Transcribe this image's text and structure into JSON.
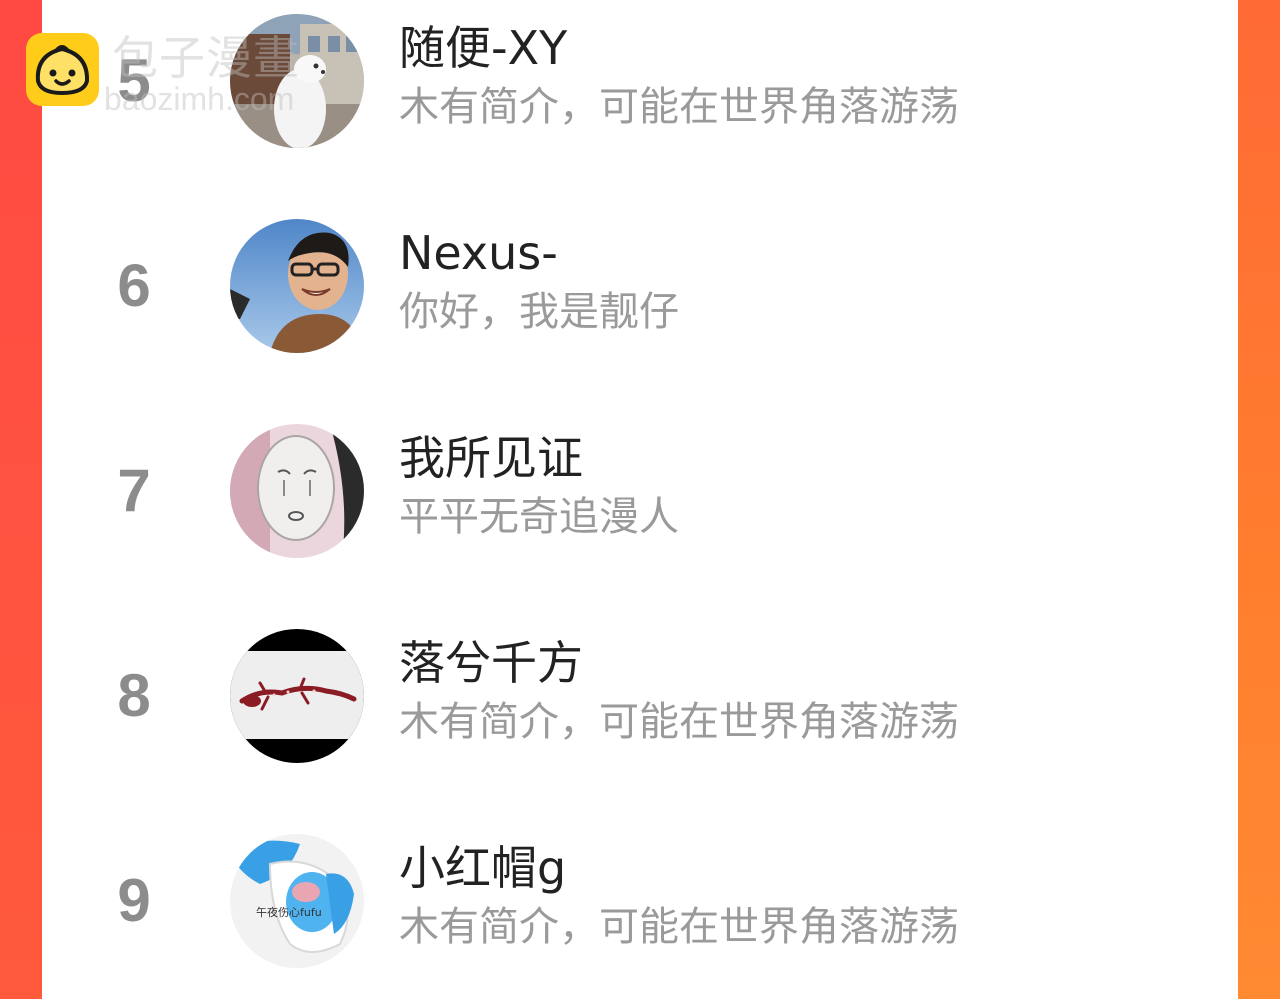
{
  "watermark": {
    "title": "包子漫畫",
    "url": "baozimh.com",
    "logo_icon": "bun-face-icon",
    "logo_color": "#ffcc1a"
  },
  "colors": {
    "side_left": "#ff4a44",
    "side_right": "#ff7f2e",
    "rank": "#8c8c8c",
    "name": "#222222",
    "bio": "#9a9a9a"
  },
  "list": [
    {
      "rank": "5",
      "name": "随便-XY",
      "bio": "木有简介，可能在世界角落游荡",
      "avatar_icon": "avatar-street-scene"
    },
    {
      "rank": "6",
      "name": "Nexus-",
      "bio": "你好，我是靓仔",
      "avatar_icon": "avatar-person-glasses"
    },
    {
      "rank": "7",
      "name": "我所见证",
      "bio": "平平无奇追漫人",
      "avatar_icon": "avatar-noface-mask"
    },
    {
      "rank": "8",
      "name": "落兮千方",
      "bio": "木有简介，可能在世界角落游荡",
      "avatar_icon": "avatar-lizard"
    },
    {
      "rank": "9",
      "name": "小红帽g",
      "bio": "木有简介，可能在世界角落游荡",
      "avatar_icon": "avatar-blue-character",
      "avatar_caption": "午夜伤心fufu"
    }
  ]
}
